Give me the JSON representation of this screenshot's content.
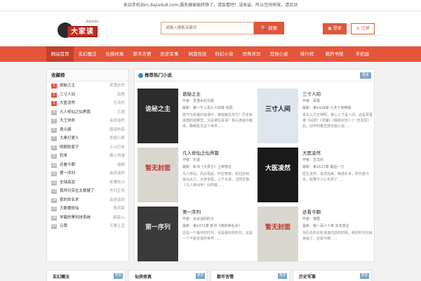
{
  "notice": "本站手机站m.dajiadu8.com,服务器偷偷转移了，请会看吧！没收益，所以空间有限，请见谅",
  "logo": {
    "text": "大家读",
    "small": "dajiadu"
  },
  "search": {
    "placeholder": "请输入搜索关键词",
    "button": "搜索"
  },
  "account": {
    "login": "登录",
    "register": "注册"
  },
  "nav": [
    "网站首页",
    "玄幻魔法",
    "仙侠修真",
    "都市言情",
    "历史军事",
    "网游竞技",
    "科幻小说",
    "恐怖灵异",
    "其他小说",
    "排行榜",
    "我的书架",
    "手机版"
  ],
  "sidebar": {
    "title": "收藏榜",
    "items": [
      {
        "rank": "1",
        "title": "诡秘之主",
        "author": "爱潜水的"
      },
      {
        "rank": "2",
        "title": "三寸人间",
        "author": "耳根"
      },
      {
        "rank": "3",
        "title": "大医凌然",
        "author": "志鸟村"
      },
      {
        "rank": "4",
        "title": "凡人修仙之仙界篇",
        "author": "忘语"
      },
      {
        "rank": "5",
        "title": "大王饶命",
        "author": "会说话的"
      },
      {
        "rank": "6",
        "title": "诡元阁",
        "author": "圆润的茄"
      },
      {
        "rank": "7",
        "title": "大奉打更人",
        "author": "卖报小郎"
      },
      {
        "rank": "8",
        "title": "明朝败家子",
        "author": "上山打老"
      },
      {
        "rank": "9",
        "title": "剑来",
        "author": "烽火戏诸"
      },
      {
        "rank": "10",
        "title": "还看今朝",
        "author": "瑞根"
      },
      {
        "rank": "11",
        "title": "第一序列",
        "author": "会说话的"
      },
      {
        "rank": "12",
        "title": "全球高武",
        "author": "老鹰吃小"
      },
      {
        "rank": "13",
        "title": "我师兄实在太稳健了",
        "author": "言归正传"
      },
      {
        "rank": "14",
        "title": "夜的命名术",
        "author": "会说话的"
      },
      {
        "rank": "15",
        "title": "大数据修仙",
        "author": "陈风笑"
      },
      {
        "rank": "16",
        "title": "学霸的黑科技系统",
        "author": "晨星LL"
      },
      {
        "rank": "17",
        "title": "元尊",
        "author": "天蚕土豆"
      }
    ]
  },
  "main": {
    "title": "推荐热门小说",
    "more": "更多",
    "books": [
      {
        "title": "诡秘之主",
        "author": "作者：爱潜水的乌贼",
        "latest": "最新：第一千三百九十四章 结局",
        "desc": "蒸汽与机械的浪潮中，谁能触及非凡？历史和黑暗的迷雾里，又是谁在耳语？我从诡秘中醒来，睁眼看见这个世界……",
        "cover_title": "诡秘之主",
        "cover_bg": "#2c2c2c",
        "cover_fg": "#e8e8e8"
      },
      {
        "title": "三寸人间",
        "author": "作者：耳根",
        "latest": "最新：第1428章 九天十地唯我",
        "desc": "举头三尺无神明，掌心三寸是人间。这是耳根继《仙逆》《求魔》《我欲封天》《一念永恒》后，创作的第五部长篇小说……",
        "cover_title": "三寸人间",
        "cover_bg": "#dfe5ec",
        "cover_fg": "#222222"
      },
      {
        "title": "凡人修仙之仙界篇",
        "author": "作者：忘语",
        "latest": "最新：新书《大夢主》上架感言",
        "desc": "凡人修仙，风云再起，时空穿梭，轮回逆转。金仙太乙，大罗道祖，三千大道，法则至尊。《凡人修仙传》仙界篇……",
        "cover_title": "暂无封面",
        "cover_bg": "#d9d6cf",
        "cover_fg": "#c0392b"
      },
      {
        "title": "大医凌然",
        "author": "作者：志鸟村",
        "latest": "最新：第1623章 最后一刀",
        "desc": "医生凌然，追求完美，精通手术，研究者众多，结果不小心实现了……",
        "cover_title": "大医凌然",
        "cover_bg": "#1a1a1a",
        "cover_fg": "#ffffff"
      },
      {
        "title": "第一序列",
        "author": "作者：会说话的肘子",
        "latest": "最新：第1472章 新书《夜的命名术》",
        "desc": "这是一个最坏的时代，也是最好的时代，这是一个不能言说的世界……",
        "cover_title": "第一序列",
        "cover_bg": "#3a3a3a",
        "cover_fg": "#dddddd"
      },
      {
        "title": "还看今朝",
        "author": "作者：瑞根",
        "latest": "最新：第一百六十章 完本感言",
        "desc": "当历史的车轮滚滚向前的时候，新的时代也就来临了，还看今朝……",
        "cover_title": "暂无封面",
        "cover_bg": "#d9d6cf",
        "cover_fg": "#c0392b"
      }
    ]
  },
  "bottom": [
    "玄幻魔法",
    "仙侠修真",
    "都市言情",
    "历史军事"
  ],
  "bottom_more": "更多"
}
